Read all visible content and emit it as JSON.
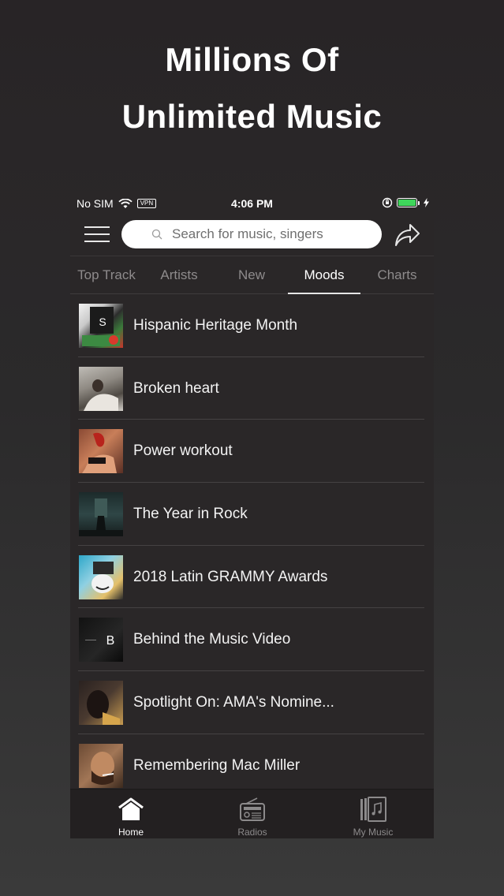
{
  "headline": {
    "line1": "Millions Of",
    "line2": "Unlimited Music"
  },
  "status_bar": {
    "carrier": "No SIM",
    "vpn": "VPN",
    "time": "4:06 PM",
    "battery_level": 1.0
  },
  "header": {
    "search_placeholder": "Search for music, singers"
  },
  "tabs": [
    {
      "label": "Top Track",
      "active": false
    },
    {
      "label": "Artists",
      "active": false
    },
    {
      "label": "New",
      "active": false
    },
    {
      "label": "Moods",
      "active": true
    },
    {
      "label": "Charts",
      "active": false
    }
  ],
  "moods": [
    {
      "title": "Hispanic Heritage Month",
      "thumb_text": "S"
    },
    {
      "title": "Broken heart"
    },
    {
      "title": "Power workout"
    },
    {
      "title": " The Year in Rock"
    },
    {
      "title": "2018 Latin GRAMMY Awards"
    },
    {
      "title": "Behind the Music Video",
      "thumb_text": "B"
    },
    {
      "title": "Spotlight On: AMA's Nomine..."
    },
    {
      "title": "Remembering Mac Miller"
    }
  ],
  "bottom_nav": [
    {
      "label": "Home",
      "icon": "home-icon",
      "active": true
    },
    {
      "label": "Radios",
      "icon": "radio-icon",
      "active": false
    },
    {
      "label": "My Music",
      "icon": "music-library-icon",
      "active": false
    }
  ],
  "colors": {
    "background": "#2a2728",
    "accent": "#ffffff",
    "battery": "#3fd65b",
    "inactive_text": "#8e8b8c"
  }
}
